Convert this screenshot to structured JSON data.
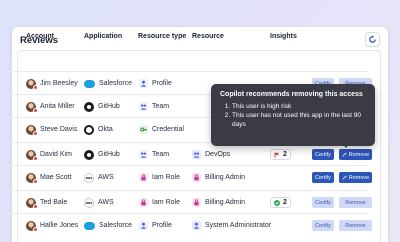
{
  "card": {
    "title": "Reviews",
    "refresh_icon": "refresh-icon"
  },
  "columns": [
    "Account",
    "Application",
    "Resource type",
    "Resource",
    "Insights"
  ],
  "rows": [
    {
      "account": "Jim Beesley",
      "app": "Salesforce",
      "app_logo": "salesforce",
      "rtype": "Profile",
      "rtype_icon": "profile",
      "resource": "",
      "res_icon": "",
      "insight": "",
      "insight_kind": "",
      "certify_style": "soft",
      "remove_style": "soft",
      "visible_actions": true
    },
    {
      "account": "Anita Miller",
      "app": "GitHub",
      "app_logo": "github",
      "rtype": "Team",
      "rtype_icon": "team",
      "resource": "",
      "res_icon": "",
      "insight": "",
      "insight_kind": "",
      "certify_style": "",
      "remove_style": "",
      "visible_actions": false
    },
    {
      "account": "Steve Davis",
      "app": "Okta",
      "app_logo": "okta",
      "rtype": "Credential",
      "rtype_icon": "cred",
      "resource": "",
      "res_icon": "",
      "insight": "",
      "insight_kind": "",
      "certify_style": "",
      "remove_style": "",
      "visible_actions": false
    },
    {
      "account": "David Kim",
      "app": "GitHub",
      "app_logo": "github",
      "rtype": "Team",
      "rtype_icon": "team",
      "resource": "DevOps",
      "res_icon": "team",
      "insight": "2",
      "insight_kind": "flag",
      "certify_style": "solid",
      "remove_style": "solid",
      "visible_actions": true
    },
    {
      "account": "Mae Scott",
      "app": "AWS",
      "app_logo": "aws",
      "rtype": "Iam Role",
      "rtype_icon": "iam",
      "resource": "Billing Admin",
      "res_icon": "iam",
      "insight": "",
      "insight_kind": "",
      "certify_style": "solid",
      "remove_style": "solid",
      "visible_actions": true
    },
    {
      "account": "Ted Bale",
      "app": "AWS",
      "app_logo": "aws",
      "rtype": "Iam Role",
      "rtype_icon": "iam",
      "resource": "Billing Admin",
      "res_icon": "iam",
      "insight": "2",
      "insight_kind": "check",
      "certify_style": "soft",
      "remove_style": "soft",
      "visible_actions": true
    },
    {
      "account": "Hallie Jones",
      "app": "Salesforce",
      "app_logo": "salesforce",
      "rtype": "Profile",
      "rtype_icon": "profile",
      "resource": "System Administrator",
      "res_icon": "profile",
      "insight": "",
      "insight_kind": "",
      "certify_style": "soft",
      "remove_style": "soft",
      "visible_actions": true
    }
  ],
  "actions": {
    "certify": "Certify",
    "remove": "Remove"
  },
  "tooltip": {
    "title": "Copilot recommends removing this access",
    "items": [
      "This user is high risk",
      "This user has not used this app in the last 90 days"
    ]
  },
  "colors": {
    "primary": "#2c55b9",
    "soft": "#cfd9f6",
    "tooltip_bg": "#3b3b45"
  }
}
